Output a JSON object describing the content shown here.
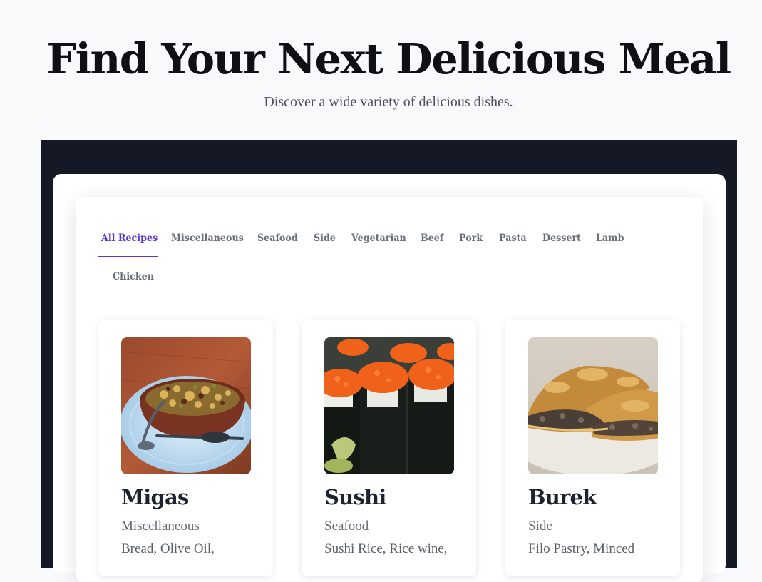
{
  "hero": {
    "title": "Find Your Next Delicious Meal",
    "subtitle": "Discover a wide variety of delicious dishes."
  },
  "tabs": [
    {
      "label": "All Recipes",
      "active": true
    },
    {
      "label": "Miscellaneous",
      "active": false
    },
    {
      "label": "Seafood",
      "active": false
    },
    {
      "label": "Side",
      "active": false
    },
    {
      "label": "Vegetarian",
      "active": false
    },
    {
      "label": "Beef",
      "active": false
    },
    {
      "label": "Pork",
      "active": false
    },
    {
      "label": "Pasta",
      "active": false
    },
    {
      "label": "Dessert",
      "active": false
    },
    {
      "label": "Lamb",
      "active": false
    },
    {
      "label": "Chicken",
      "active": false
    }
  ],
  "recipes": [
    {
      "name": "Migas",
      "category": "Miscellaneous",
      "ingredients": "Bread, Olive Oil,",
      "image": "migas-photo"
    },
    {
      "name": "Sushi",
      "category": "Seafood",
      "ingredients": "Sushi Rice, Rice wine,",
      "image": "sushi-photo"
    },
    {
      "name": "Burek",
      "category": "Side",
      "ingredients": "Filo Pastry, Minced",
      "image": "burek-photo"
    }
  ],
  "colors": {
    "accent": "#5b33d6",
    "page_background": "#f8f9fb",
    "frame_background": "#141925",
    "title_text": "#0f0f14",
    "tab_text": "#6b6f7a"
  }
}
